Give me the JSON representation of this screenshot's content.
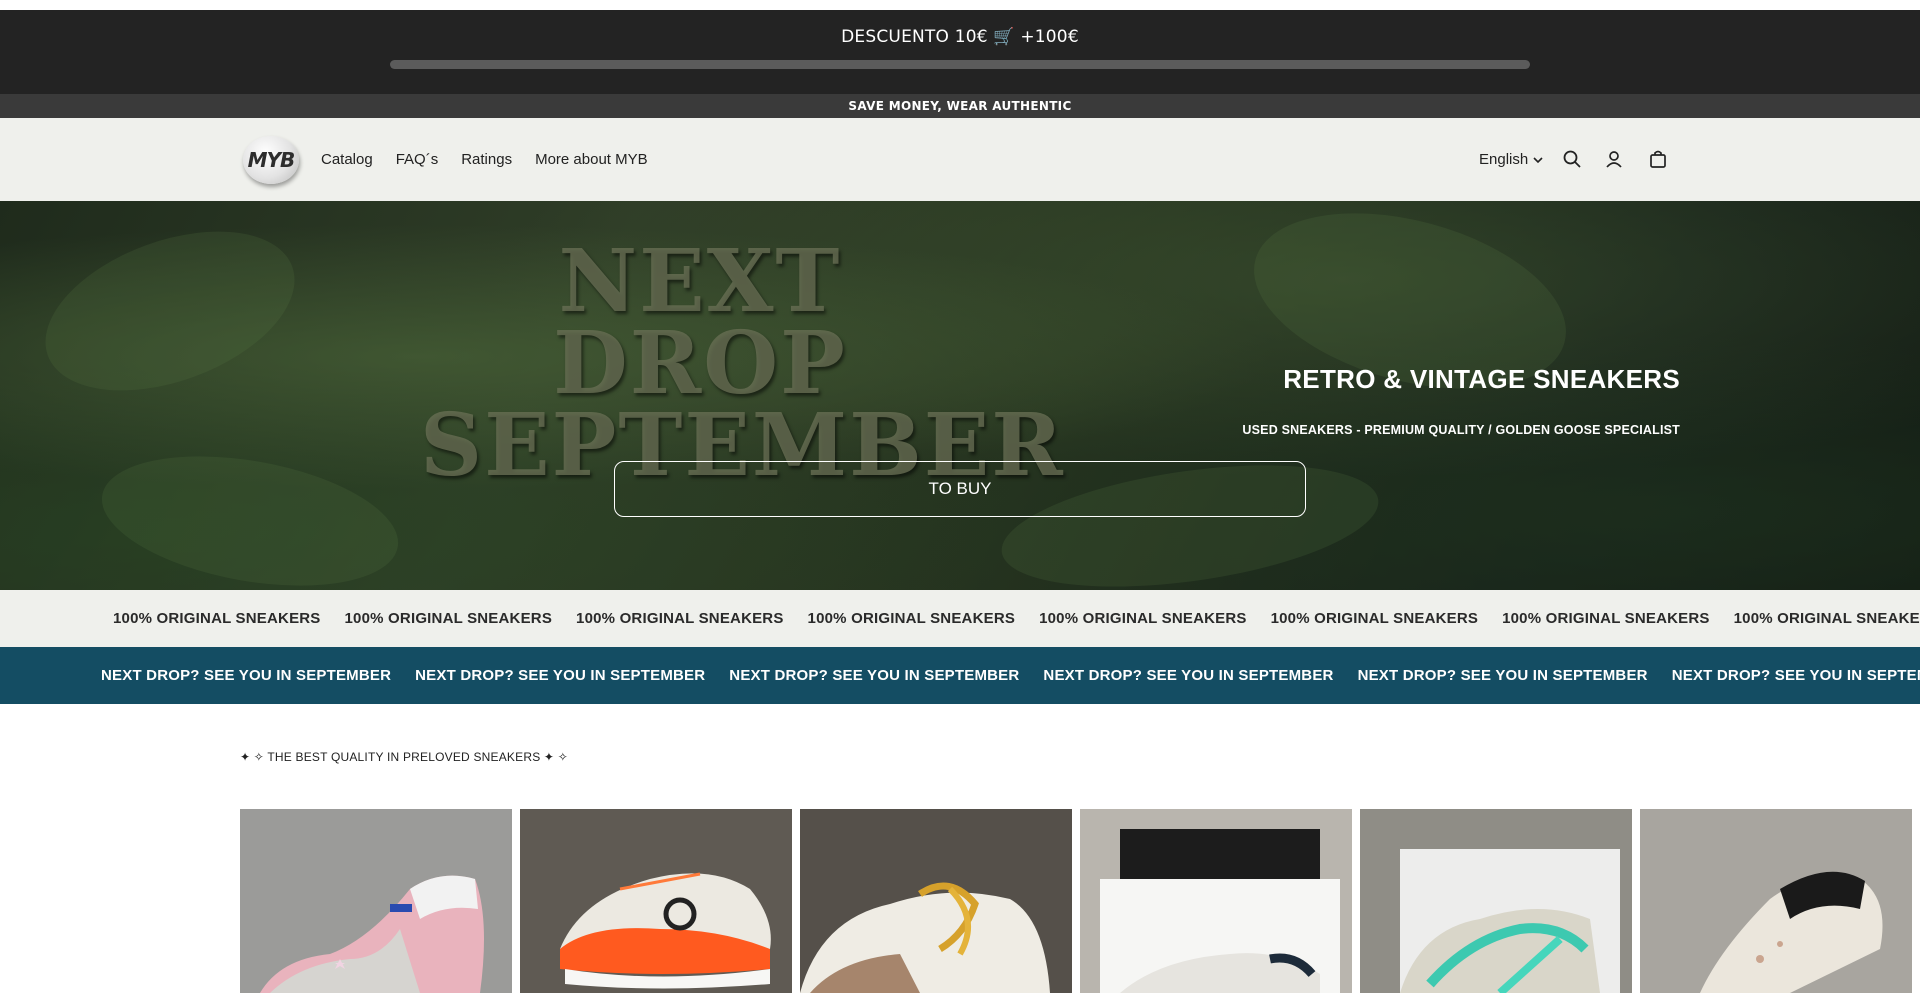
{
  "promo": {
    "text": "DESCUENTO 10€ 🛒 +100€",
    "progress": 0
  },
  "announcement": "SAVE MONEY, WEAR AUTHENTIC",
  "header": {
    "logo_text": "MYB",
    "nav": [
      "Catalog",
      "FAQ´s",
      "Ratings",
      "More about MYB"
    ],
    "language": "English",
    "icons": [
      "search-icon",
      "account-icon",
      "cart-icon"
    ]
  },
  "hero": {
    "big_lines": [
      "NEXT",
      "DROP",
      "SEPTEMBER"
    ],
    "title": "RETRO & VINTAGE SNEAKERS",
    "subtitle": "USED SNEAKERS - PREMIUM QUALITY / GOLDEN GOOSE SPECIALIST",
    "button": "TO BUY"
  },
  "marquee1": {
    "text": "100% ORIGINAL SNEAKERS",
    "bg": "#eff0ec"
  },
  "marquee2": {
    "text": "NEXT DROP? SEE YOU IN SEPTEMBER",
    "bg": "#144d63"
  },
  "tagline": "✦ ✧ THE BEST QUALITY IN PRELOVED SNEAKERS ✦ ✧",
  "products": [
    {
      "name": "product-pink-star-sneaker",
      "bg": "#9b9b99"
    },
    {
      "name": "product-white-orange-runner",
      "bg": "#5f5a53"
    },
    {
      "name": "product-white-gold-lace",
      "bg": "#55504a"
    },
    {
      "name": "product-white-black-box",
      "bg": "#b9b5ae"
    },
    {
      "name": "product-mint-sneaker",
      "bg": "#8f8d86"
    },
    {
      "name": "product-black-grey-sneaker",
      "bg": "#a8a59f"
    }
  ]
}
